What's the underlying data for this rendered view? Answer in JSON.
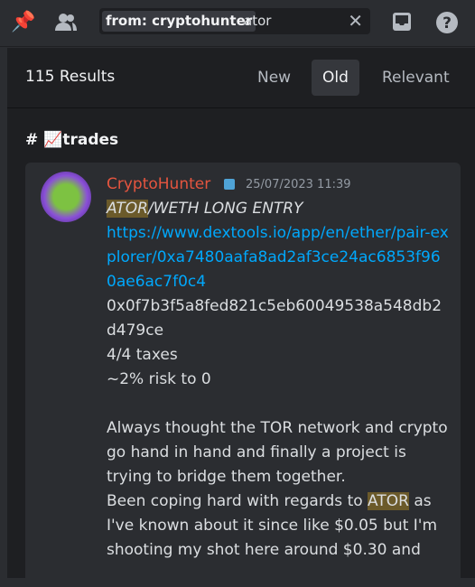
{
  "toolbar": {
    "pin_icon": "pin-icon",
    "members_icon": "members-icon",
    "inbox_icon": "inbox-icon",
    "help_icon": "help-icon"
  },
  "search": {
    "filter_chip": "from: cryptohunter",
    "query": "ator",
    "clear": "✕"
  },
  "results": {
    "count": "115 Results",
    "sort": [
      "New",
      "Old",
      "Relevant"
    ],
    "active_sort": "Old"
  },
  "channel": {
    "hash": "#",
    "emoji": "📈",
    "name": "trades"
  },
  "message": {
    "author": "CryptoHunter",
    "author_color": "#e5553f",
    "timestamp": "25/07/2023 11:39",
    "title_hl": "ATOR",
    "title_rest": "/WETH LONG ENTRY",
    "link": "https://www.dextools.io/app/en/ether/pair-explorer/0xa7480aafa8ad2af3ce24ac6853f960ae6ac7f0c4",
    "address": "0x0f7b3f5a8fed821c5eb60049538a548db2d479ce",
    "taxes": "4/4 taxes",
    "risk": "~2% risk to 0",
    "para1": "Always thought the TOR network and crypto go hand in hand and finally a project is trying to bridge them together.",
    "para2_a": "Been coping hard with regards to ",
    "para2_hl": "ATOR",
    "para2_b": " as I've known about it since like $0.05 but I'm shooting my shot here around $0.30 and"
  },
  "colors": {
    "highlight": "#6b5a2a",
    "link": "#00a8fc",
    "panel": "#1e1f22"
  }
}
